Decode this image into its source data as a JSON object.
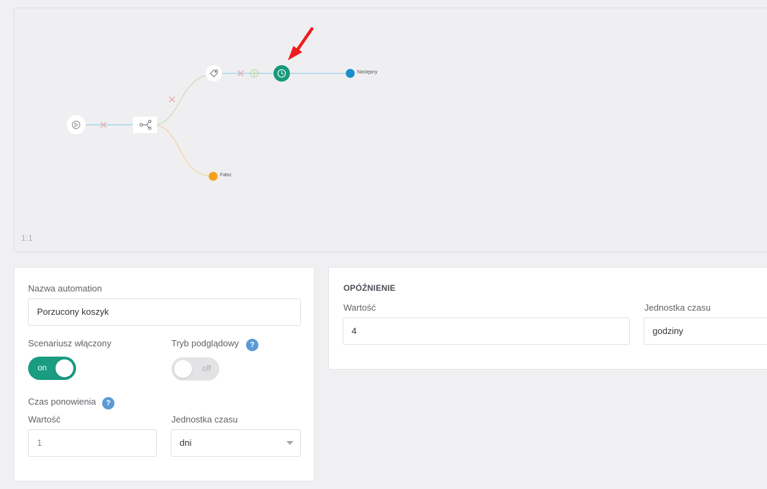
{
  "canvas": {
    "zoom_label": "1:1",
    "nodes": {
      "start": {
        "icon": "play-icon"
      },
      "split": {
        "icon": "split-icon"
      },
      "tag": {
        "icon": "tag-icon"
      },
      "delay": {
        "icon": "clock-icon",
        "color": "#179a7c"
      },
      "next": {
        "label": "Następny",
        "color": "#1a8fc9"
      },
      "false": {
        "label": "Fałsz",
        "color": "#f5a01a"
      }
    },
    "arrow_color": "#ee1c1c"
  },
  "automation_panel": {
    "name_label": "Nazwa automation",
    "name_value": "Porzucony koszyk",
    "scenario_label": "Scenariusz włączony",
    "scenario_toggle_text": "on",
    "preview_label": "Tryb podglądowy",
    "preview_toggle_text": "off",
    "retry_label": "Czas ponowienia",
    "help_glyph": "?",
    "value_label": "Wartość",
    "value": "1",
    "unit_label": "Jednostka czasu",
    "unit_value": "dni"
  },
  "delay_panel": {
    "title": "OPÓŹNIENIE",
    "value_label": "Wartość",
    "value": "4",
    "unit_label": "Jednostka czasu",
    "unit_value": "godziny"
  },
  "colors": {
    "accent": "#199c82",
    "help": "#5b9bd5"
  }
}
